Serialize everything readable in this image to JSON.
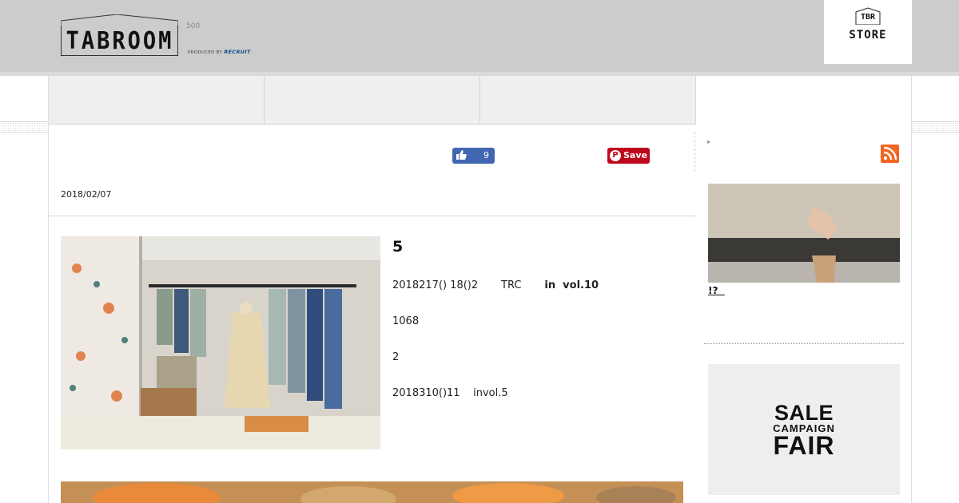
{
  "header": {
    "logo_text": "TABROOM",
    "logo_sub": "500",
    "produced_by": "PRODUCED BY",
    "produced_brand": "RECRUIT",
    "store_top": "TBR",
    "store_label": "STORE"
  },
  "social": {
    "like_count": "9",
    "save_label": "Save"
  },
  "article": {
    "date": "2018/02/07",
    "heading": "5",
    "para1": "2018217() 18()2       TRC",
    "para1_bold": "in  vol.10",
    "para2": "1068",
    "para3": "2",
    "para4": "2018310()11    invol.5"
  },
  "sidebar": {
    "link_text": "!?  ",
    "sale_line1": "SALE",
    "sale_line2": "CAMPAIGN",
    "sale_line3": "FAIR"
  },
  "colors": {
    "header_bg": "#cccccc",
    "facebook": "#4267b2",
    "pinterest": "#bd081c",
    "rss": "#f26522"
  },
  "icons": [
    "thumbs-up-icon",
    "pinterest-icon",
    "rss-icon",
    "arrow-right-icon"
  ]
}
